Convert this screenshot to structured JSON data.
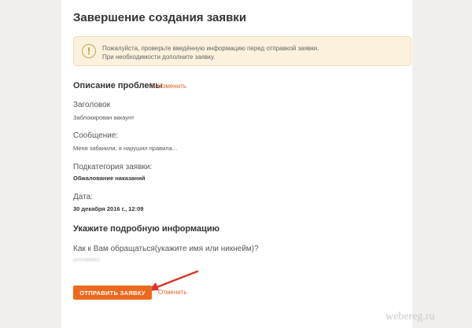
{
  "page": {
    "title": "Завершение создания заявки"
  },
  "notice": {
    "line1": "Пожалуйста, проверьте введённую информацию перед отправкой заявки.",
    "line2": "При необходимости дополните заявку."
  },
  "problem": {
    "title": "Описание проблемы",
    "edit_label": "Изменить",
    "fields": [
      {
        "label": "Заголовок",
        "value": "Заблокирован аккаунт"
      },
      {
        "label": "Сообщение:",
        "value": "Меня забанили, я нарушил правила..."
      },
      {
        "label": "Подкатегория заявки:",
        "value": "Обжалование наказаний"
      },
      {
        "label": "Дата:",
        "value": "30 декабря 2016 г., 12:09"
      }
    ]
  },
  "details": {
    "title": "Укажите подробную информацию",
    "question": "Как к Вам обращаться(укажите имя или никнейм)?",
    "answer": "yurimak8881"
  },
  "actions": {
    "submit_label": "ОТПРАВИТЬ ЗАЯВКУ",
    "cancel_label": "Отменить"
  },
  "watermark": "webereg.ru",
  "colors": {
    "accent": "#ec6a1f",
    "notice_bg": "#fbf1dc",
    "annotation_arrow": "#d9362b"
  },
  "icons": {
    "notice": "exclamation-icon",
    "edit": "pencil-icon"
  }
}
